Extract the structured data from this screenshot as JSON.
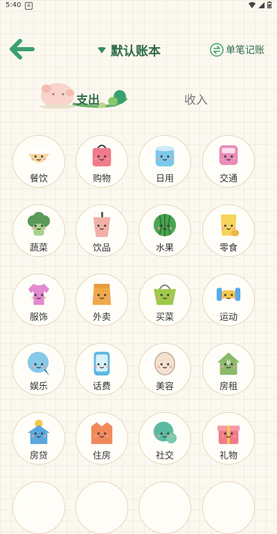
{
  "status": {
    "time": "5:40",
    "notif": "A"
  },
  "header": {
    "book_title": "默认账本",
    "single_entry_label": "单笔记账"
  },
  "tabs": {
    "expense": "支出",
    "income": "收入"
  },
  "categories": [
    {
      "label": "餐饮",
      "icon": "rice-bowl-icon",
      "color": "#f5d9a0"
    },
    {
      "label": "购物",
      "icon": "shopping-bag-icon",
      "color": "#f07a8a"
    },
    {
      "label": "日用",
      "icon": "tissue-roll-icon",
      "color": "#7ac8ea"
    },
    {
      "label": "交通",
      "icon": "bus-icon",
      "color": "#e98bb8"
    },
    {
      "label": "蔬菜",
      "icon": "broccoli-icon",
      "color": "#5a9a5a"
    },
    {
      "label": "饮品",
      "icon": "bubble-tea-icon",
      "color": "#f0b0a8"
    },
    {
      "label": "水果",
      "icon": "watermelon-icon",
      "color": "#4aa552"
    },
    {
      "label": "零食",
      "icon": "snack-bag-icon",
      "color": "#f5d45a"
    },
    {
      "label": "服饰",
      "icon": "tshirt-icon",
      "color": "#e28ad0"
    },
    {
      "label": "外卖",
      "icon": "takeout-bag-icon",
      "color": "#f0a84a"
    },
    {
      "label": "买菜",
      "icon": "basket-icon",
      "color": "#9ec94a"
    },
    {
      "label": "运动",
      "icon": "dumbbell-icon",
      "color": "#5aa8e8"
    },
    {
      "label": "娱乐",
      "icon": "chat-bubble-icon",
      "color": "#88c8e8"
    },
    {
      "label": "话费",
      "icon": "phone-icon",
      "color": "#5ab8e0"
    },
    {
      "label": "美容",
      "icon": "face-mask-icon",
      "color": "#f5e0d0"
    },
    {
      "label": "房租",
      "icon": "house-yen-icon",
      "color": "#8aba6a"
    },
    {
      "label": "房贷",
      "icon": "house-coin-icon",
      "color": "#5aa8e0"
    },
    {
      "label": "住房",
      "icon": "building-icon",
      "color": "#f08a5a"
    },
    {
      "label": "社交",
      "icon": "speech-bubbles-icon",
      "color": "#5abaa0"
    },
    {
      "label": "礼物",
      "icon": "gift-icon",
      "color": "#f07a8a"
    }
  ]
}
